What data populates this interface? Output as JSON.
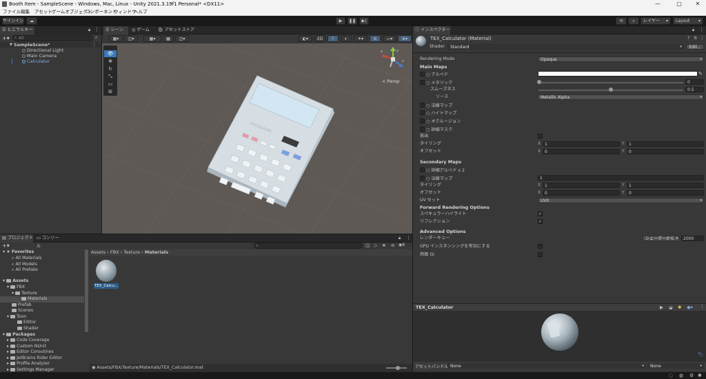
{
  "window": {
    "title": "Booth Item - SampleScene - Windows, Mac, Linux - Unity 2021.3.19f1 Personal* <DX11>"
  },
  "menu": [
    "ファイル",
    "編集",
    "アセット",
    "ゲームオブジェクト",
    "コンポーネント",
    "ウィンドウ",
    "ヘルプ"
  ],
  "toolbar": {
    "signin": "サインイン",
    "layers": "レイヤー",
    "layout": "Layout"
  },
  "hierarchy": {
    "tab": "ヒエラルキー",
    "search_placeholder": "All",
    "scene": "SampleScene*",
    "items": [
      "Directional Light",
      "Main Camera",
      "Calculator"
    ]
  },
  "scene_view": {
    "tabs": [
      "シーン",
      "ゲーム",
      "アセットストア"
    ],
    "mode_2d": "2D",
    "persp": "< Persp",
    "gizmo_labels": {
      "x": "x",
      "y": "y",
      "z": "z"
    }
  },
  "project": {
    "tabs": [
      "プロジェクト",
      "コンソール"
    ],
    "favorites": {
      "label": "Favorites",
      "items": [
        "All Materials",
        "All Models",
        "All Prefabs"
      ]
    },
    "assets": {
      "label": "Assets",
      "tree": [
        {
          "label": "FBX",
          "depth": 1
        },
        {
          "label": "Texture",
          "depth": 2
        },
        {
          "label": "Materials",
          "depth": 3
        },
        {
          "label": "Prefab",
          "depth": 1
        },
        {
          "label": "Scenes",
          "depth": 1
        },
        {
          "label": "Toon",
          "depth": 1
        },
        {
          "label": "Editor",
          "depth": 2
        },
        {
          "label": "Shader",
          "depth": 2
        }
      ]
    },
    "packages": {
      "label": "Packages",
      "items": [
        "Code Coverage",
        "Custom NUnit",
        "Editor Coroutines",
        "JetBrains Rider Editor",
        "Profile Analyzer",
        "Settings Manager"
      ]
    },
    "breadcrumb": [
      "Assets",
      "FBX",
      "Texture",
      "Materials"
    ],
    "asset_name": "TEX_Calcu...",
    "path": "Assets/FBX/Texture/Materials/TEX_Calculator.mat",
    "badge_count": "8"
  },
  "inspector": {
    "tab": "インスペクター",
    "material_title": "TEX_Calculator (Material)",
    "shader_label": "Shader",
    "shader_value": "Standard",
    "edit_button": "Edit...",
    "rendering_mode_label": "Rendering Mode",
    "rendering_mode": "Opaque",
    "main_maps": "Main Maps",
    "albedo": "アルベド",
    "metallic": "メタリック",
    "metallic_value": "0",
    "smoothness": "スムーズネス",
    "smoothness_value": "0.5",
    "source": "ソース",
    "source_value": "Metallic Alpha",
    "normal_map": "法線マップ",
    "height_map": "ハイトマップ",
    "occlusion": "オクルージョン",
    "detail_mask": "詳細マスク",
    "emission": "放出",
    "tiling": "タイリング",
    "offset": "オフセット",
    "tiling_x": "1",
    "tiling_y": "1",
    "offset_x": "0",
    "offset_y": "0",
    "secondary_maps": "Secondary Maps",
    "detail_albedo": "詳細アルベド x 2",
    "normal_map_2": "法線マップ",
    "normal_scale": "1",
    "tiling2_x": "1",
    "tiling2_y": "1",
    "offset2_x": "0",
    "offset2_y": "0",
    "uv_set": "UV セット",
    "uv_set_value": "UV0",
    "forward_options": "Forward Rendering Options",
    "specular_highlights": "スペキュラーハイライト",
    "reflections": "リフレクション",
    "advanced_options": "Advanced Options",
    "render_queue": "レンダーキュー",
    "render_queue_source": "シェーダーから",
    "render_queue_value": "2000",
    "gpu_instancing": "GPU インスタンシングを有効にする",
    "double_sided_gi": "両面 GI",
    "preview_title": "TEX_Calculator",
    "asset_bundle_label": "アセットバンドル",
    "asset_bundle_value": "None",
    "asset_bundle_variant": "None"
  },
  "calculator": {
    "display": "",
    "brand": "CALCULATOR"
  },
  "colors": {
    "accent": "#3a79bb",
    "panel": "#383838",
    "scene_bg": "#5e5955"
  }
}
